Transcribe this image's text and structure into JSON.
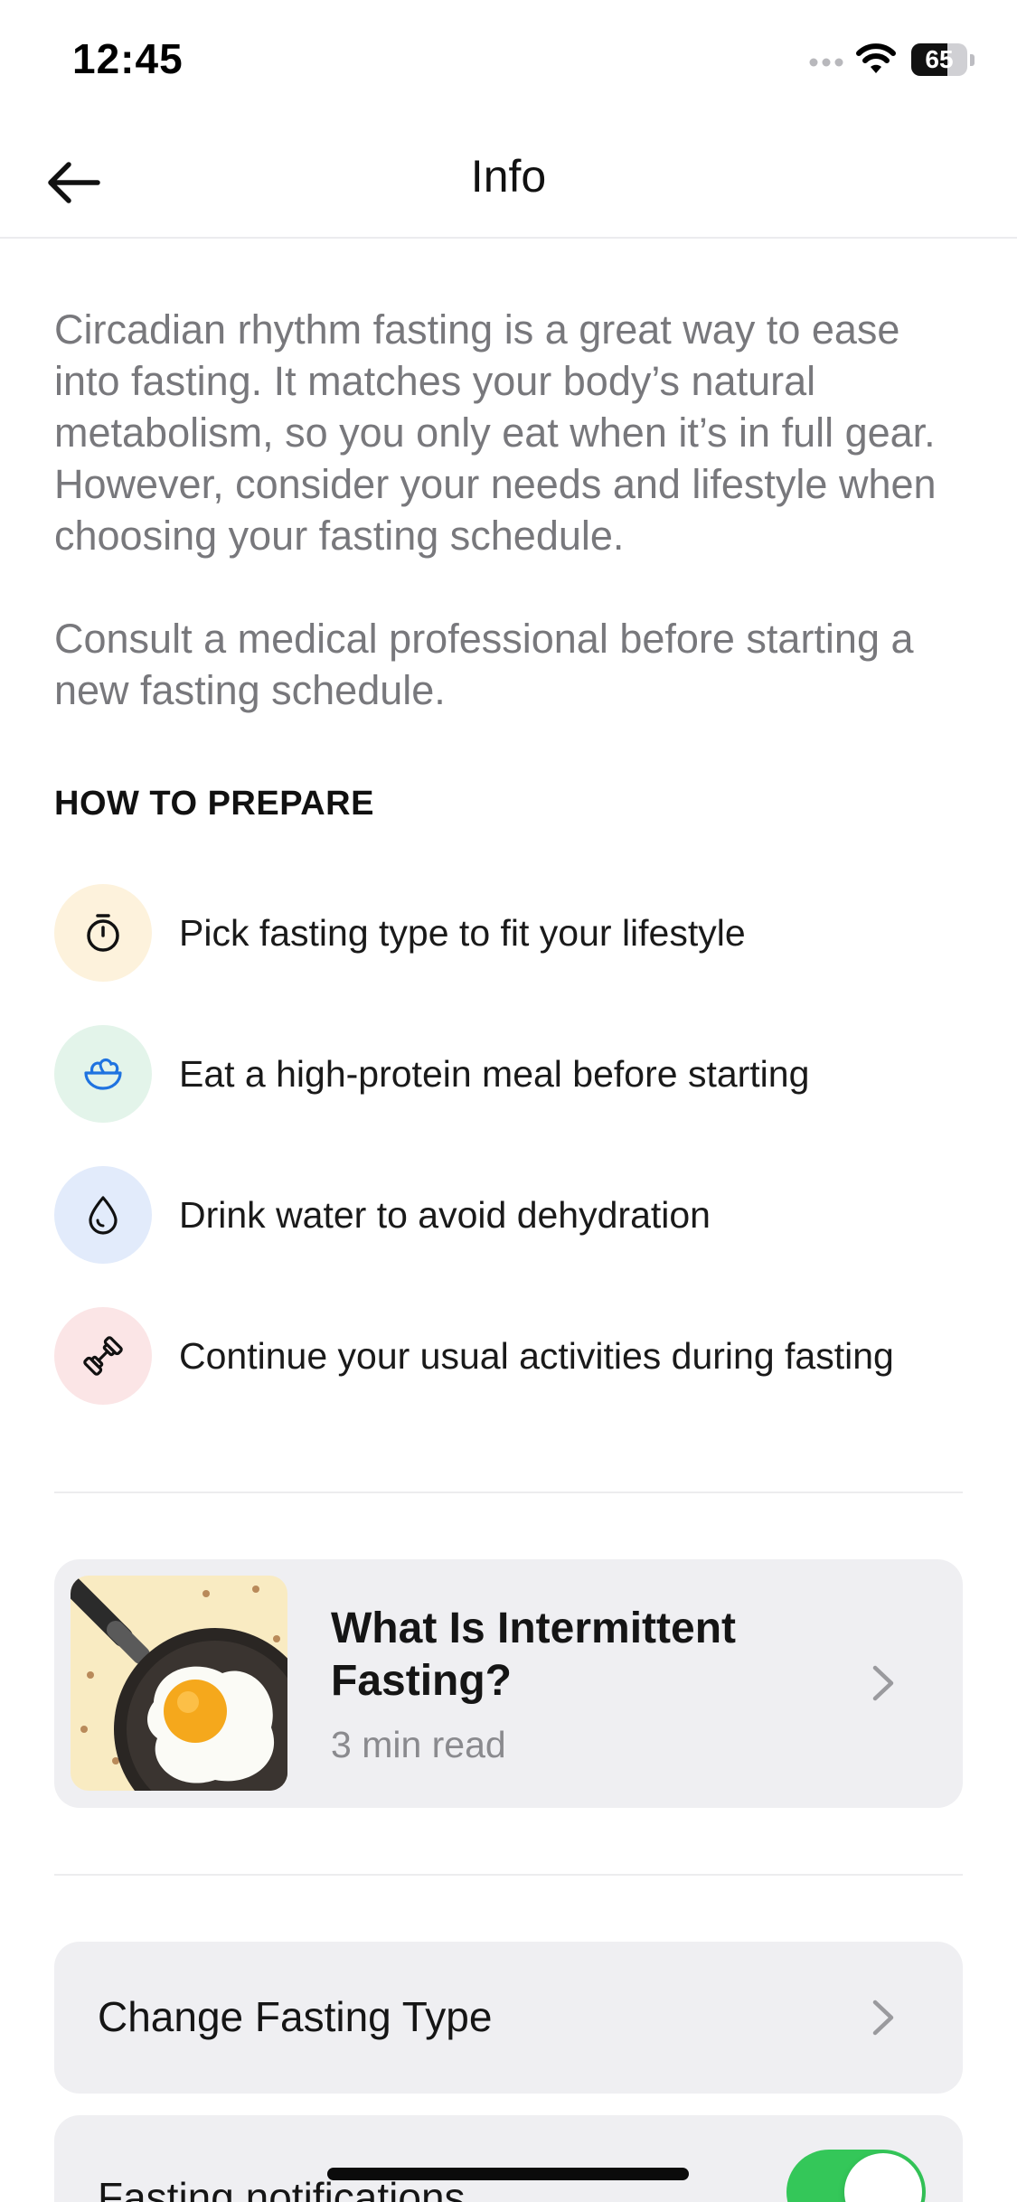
{
  "status_bar": {
    "time": "12:45",
    "battery_level": "65",
    "battery_fraction": 0.65
  },
  "nav": {
    "title": "Info",
    "back_icon": "arrow-left-icon"
  },
  "intro": {
    "paragraph_1": "Circadian rhythm fasting is a great way to ease into fasting. It matches your body’s natural metabolism, so you only eat when it’s in full gear. However, consider your needs and lifestyle when choosing your fasting schedule.",
    "paragraph_2": "Consult a medical professional before starting a new fasting schedule."
  },
  "prepare": {
    "heading": "HOW TO PREPARE",
    "items": [
      {
        "icon": "stopwatch-icon",
        "bg": "#fdf2dc",
        "label": "Pick fasting type to fit your lifestyle"
      },
      {
        "icon": "salad-bowl-icon",
        "bg": "#e3f4ea",
        "label": "Eat a high-protein meal before starting"
      },
      {
        "icon": "water-drop-icon",
        "bg": "#e2ebfb",
        "label": "Drink water to avoid dehydration"
      },
      {
        "icon": "dumbbell-icon",
        "bg": "#fbe5e6",
        "label": "Continue your usual activities during fasting"
      }
    ]
  },
  "article": {
    "title": "What Is Intermittent Fasting?",
    "meta": "3 min read",
    "thumbnail": "fried-egg-pan-image"
  },
  "settings": {
    "change_type_label": "Change Fasting Type",
    "notifications_label": "Fasting notifications",
    "notifications_on": true
  },
  "colors": {
    "toggle_on": "#34c759",
    "card_bg": "#efeff2",
    "muted_text": "#78787c"
  }
}
